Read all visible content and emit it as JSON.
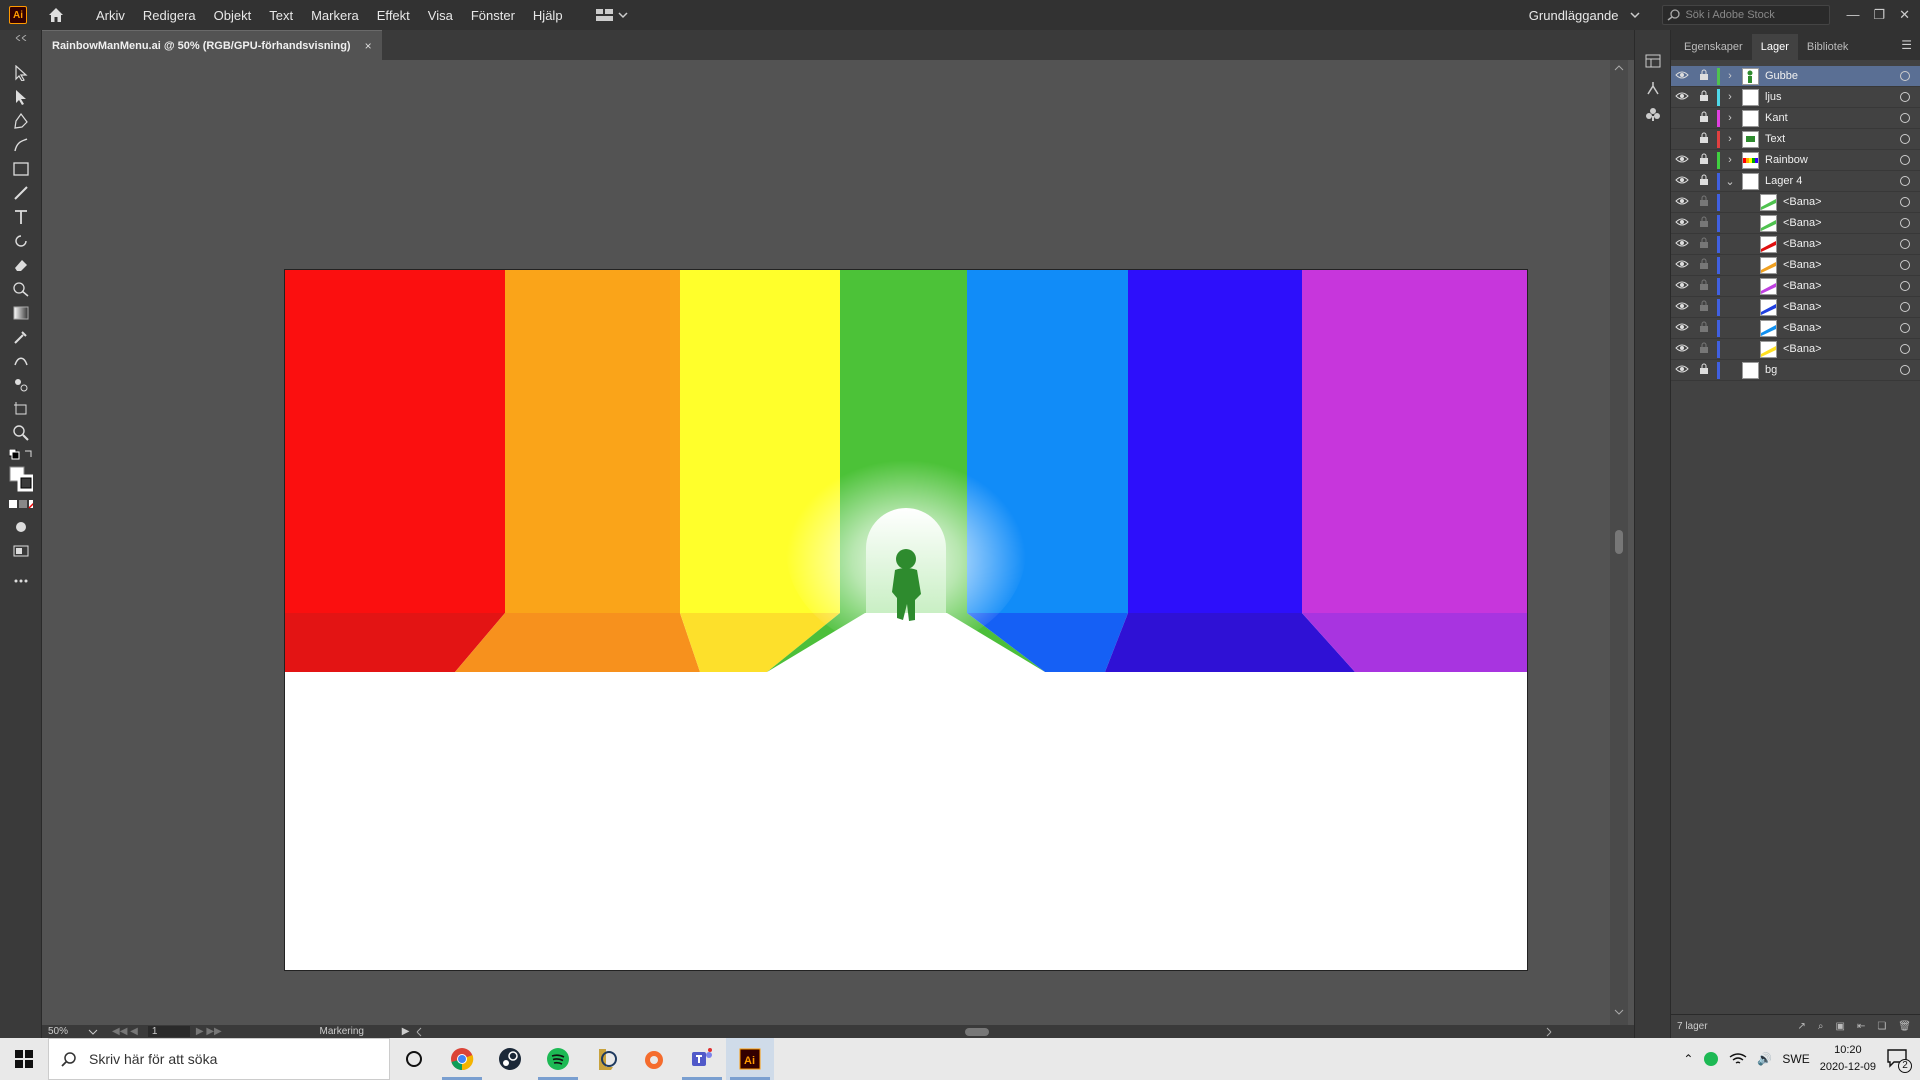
{
  "app": {
    "logo": "Ai",
    "menu": [
      "Arkiv",
      "Redigera",
      "Objekt",
      "Text",
      "Markera",
      "Effekt",
      "Visa",
      "Fönster",
      "Hjälp"
    ],
    "workspace": "Grundläggande",
    "stock_search_placeholder": "Sök i Adobe Stock"
  },
  "document": {
    "tab_title": "RainbowManMenu.ai @ 50% (RGB/GPU-förhandsvisning)",
    "close_glyph": "×"
  },
  "status": {
    "zoom": "50%",
    "artboard_number": "1",
    "tool_label": "Markering"
  },
  "panel": {
    "tabs": [
      "Egenskaper",
      "Lager",
      "Bibliotek"
    ],
    "active_tab": "Lager",
    "layers": [
      {
        "name": "Gubbe",
        "color": "#4fc24f",
        "expanded": false,
        "selected": true,
        "visible": true,
        "thumb": "figure"
      },
      {
        "name": "ljus",
        "color": "#4fd8e8",
        "expanded": false,
        "selected": false,
        "visible": true,
        "thumb": "blank"
      },
      {
        "name": "Kant",
        "color": "#e040e0",
        "expanded": false,
        "selected": false,
        "visible": false,
        "thumb": "blank"
      },
      {
        "name": "Text",
        "color": "#e04040",
        "expanded": false,
        "selected": false,
        "visible": false,
        "thumb": "text"
      },
      {
        "name": "Rainbow",
        "color": "#40d040",
        "expanded": false,
        "selected": false,
        "visible": true,
        "thumb": "rainbow"
      },
      {
        "name": "Lager 4",
        "color": "#4060e0",
        "expanded": true,
        "selected": false,
        "visible": true,
        "thumb": "blank"
      }
    ],
    "sublayers": [
      {
        "name": "<Bana>",
        "thumb_color": "#4fc24f"
      },
      {
        "name": "<Bana>",
        "thumb_color": "#4fc24f"
      },
      {
        "name": "<Bana>",
        "thumb_color": "#e01010"
      },
      {
        "name": "<Bana>",
        "thumb_color": "#f0a020"
      },
      {
        "name": "<Bana>",
        "thumb_color": "#c040e0"
      },
      {
        "name": "<Bana>",
        "thumb_color": "#2040e0"
      },
      {
        "name": "<Bana>",
        "thumb_color": "#1090f0"
      },
      {
        "name": "<Bana>",
        "thumb_color": "#ffe020"
      }
    ],
    "bg_layer": {
      "name": "bg",
      "color": "#4060e0"
    },
    "footer_count": "7 lager"
  },
  "artwork": {
    "stripe_colors": [
      "#fb0f0f",
      "#faa419",
      "#ffff2b",
      "#4cc238",
      "#118cf8",
      "#2d0ffb",
      "#c736dc"
    ],
    "floor_colors": [
      "#e31414",
      "#f7911d",
      "#fde02b",
      "#4cbf3a",
      "#1560f5",
      "#2f11d5",
      "#a834e0"
    ],
    "figure_color": "#2e8b2e"
  },
  "taskbar": {
    "search_placeholder": "Skriv här för att söka",
    "language": "SWE",
    "time": "10:20",
    "date": "2020-12-09",
    "notification_count": "2",
    "apps": [
      "cortana",
      "chrome",
      "steam",
      "spotify",
      "league",
      "origin",
      "teams",
      "illustrator"
    ]
  }
}
